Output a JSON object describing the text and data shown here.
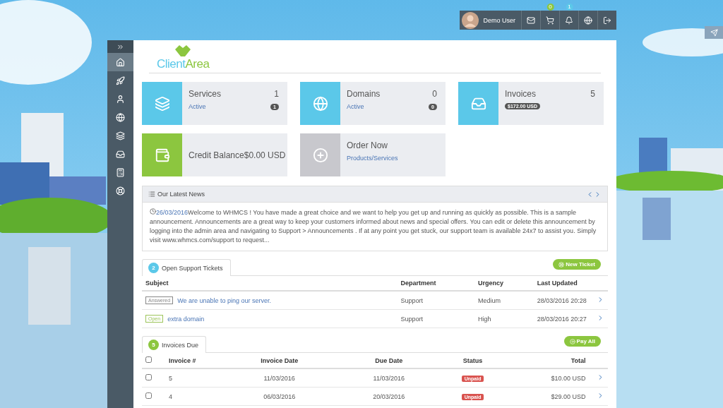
{
  "top_bar": {
    "user": "Demo User",
    "cart_count": "0",
    "notification_count": "1"
  },
  "sidebar": {
    "items": [
      {
        "selected": true
      },
      {
        "selected": false
      },
      {
        "selected": false
      },
      {
        "selected": false
      },
      {
        "selected": false
      },
      {
        "selected": false
      },
      {
        "selected": false
      },
      {
        "selected": false
      }
    ]
  },
  "logo": {
    "part_1": "Client",
    "part_2": "Area"
  },
  "tiles": [
    {
      "kind": "stat",
      "title": "Services",
      "count": "1",
      "link": "Active",
      "badge": "1",
      "color": "#5bc8e9"
    },
    {
      "kind": "stat",
      "title": "Domains",
      "count": "0",
      "link": "Active",
      "badge": "0",
      "color": "#5bc8e9"
    },
    {
      "kind": "stat",
      "title": "Invoices",
      "count": "5",
      "badge": "$172.00 USD",
      "color": "#5bc8e9"
    },
    {
      "kind": "balance",
      "title": "Credit Balance",
      "value": "$0.00 USD",
      "color": "#8cc63f"
    },
    {
      "kind": "order",
      "title": "Order Now",
      "link": "Products/Services",
      "color": "#c8c8cd"
    }
  ],
  "news": {
    "title": "Our Latest News",
    "date": "26/03/2016",
    "text": "Welcome to WHMCS ! You have made a great choice and we want to help you get up and running as quickly as possible. This is a sample announcement. Announcements are a great way to keep your customers informed about news and special offers. You can edit or delete this announcement by logging into the admin area and navigating to Support > Announcements . If at any point you get stuck, our support team is available 24x7 to assist you. Simply visit www.whmcs.com/support to request..."
  },
  "tickets": {
    "count": "2",
    "title": "Open Support Tickets",
    "button": "New Ticket",
    "columns": [
      "Subject",
      "Department",
      "Urgency",
      "Last Updated"
    ],
    "rows": [
      {
        "status": "Answered",
        "color": "#888888",
        "subject": "We are unable to ping our server.",
        "department": "Support",
        "urgency": "Medium",
        "updated": "28/03/2016 20:28"
      },
      {
        "status": "Open",
        "color": "#9cc45a",
        "subject": "extra domain",
        "department": "Support",
        "urgency": "High",
        "updated": "28/03/2016 20:27"
      }
    ]
  },
  "invoices": {
    "count": "5",
    "title": "Invoices Due",
    "button": "Pay All",
    "all_checked": false,
    "columns": [
      "Invoice #",
      "Invoice Date",
      "Due Date",
      "Status",
      "Total"
    ],
    "rows": [
      {
        "checked": false,
        "number": "5",
        "date": "11/03/2016",
        "due": "11/03/2016",
        "status": "Unpaid",
        "total": "$10.00 USD"
      },
      {
        "checked": false,
        "number": "4",
        "date": "06/03/2016",
        "due": "20/03/2016",
        "status": "Unpaid",
        "total": "$29.00 USD"
      }
    ]
  }
}
